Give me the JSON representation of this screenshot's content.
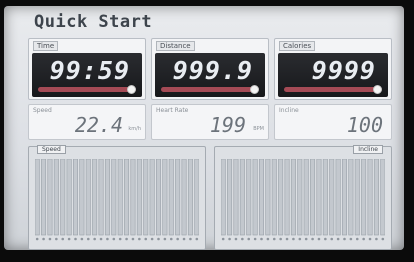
{
  "screen": {
    "title": "Quick Start"
  },
  "cards": [
    {
      "id": "time",
      "label": "Time",
      "value": "99:59"
    },
    {
      "id": "distance",
      "label": "Distance",
      "value": "999.9"
    },
    {
      "id": "calories",
      "label": "Calories",
      "value": "9999"
    }
  ],
  "stats": [
    {
      "id": "speed",
      "label": "Speed",
      "value": "22.4",
      "unit": "km/h"
    },
    {
      "id": "heart",
      "label": "Heart Rate",
      "value": "199",
      "unit": "BPM"
    },
    {
      "id": "incline",
      "label": "Incline",
      "value": "100"
    }
  ],
  "graphs": {
    "left_tag": "Speed",
    "right_tag": "Incline"
  }
}
